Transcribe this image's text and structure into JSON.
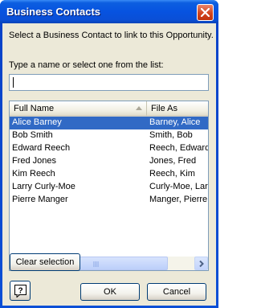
{
  "window": {
    "title": "Business Contacts"
  },
  "dialog": {
    "prompt": "Select a Business Contact to link to this Opportunity.",
    "type_label": "Type a name or select one from the list:",
    "search_value": ""
  },
  "list": {
    "columns": [
      "Full Name",
      "File As"
    ],
    "rows": [
      {
        "full_name": "Alice Barney",
        "file_as": "Barney, Alice",
        "selected": true
      },
      {
        "full_name": "Bob Smith",
        "file_as": "Smith, Bob",
        "selected": false
      },
      {
        "full_name": "Edward Reech",
        "file_as": "Reech, Edward",
        "selected": false
      },
      {
        "full_name": "Fred Jones",
        "file_as": "Jones, Fred",
        "selected": false
      },
      {
        "full_name": "Kim Reech",
        "file_as": "Reech, Kim",
        "selected": false
      },
      {
        "full_name": "Larry Curly-Moe",
        "file_as": "Curly-Moe, Larry",
        "selected": false
      },
      {
        "full_name": "Pierre Manger",
        "file_as": "Manger, Pierre",
        "selected": false
      }
    ]
  },
  "buttons": {
    "clear_selection": "Clear selection",
    "ok": "OK",
    "cancel": "Cancel"
  },
  "icons": {
    "close": "close-icon",
    "help": "help-icon",
    "sort": "sort-ascending-icon"
  },
  "colors": {
    "selection": "#316ac5",
    "titlebar": "#0753e0",
    "close_button": "#d2451e",
    "dialog_face": "#ece9d8"
  }
}
